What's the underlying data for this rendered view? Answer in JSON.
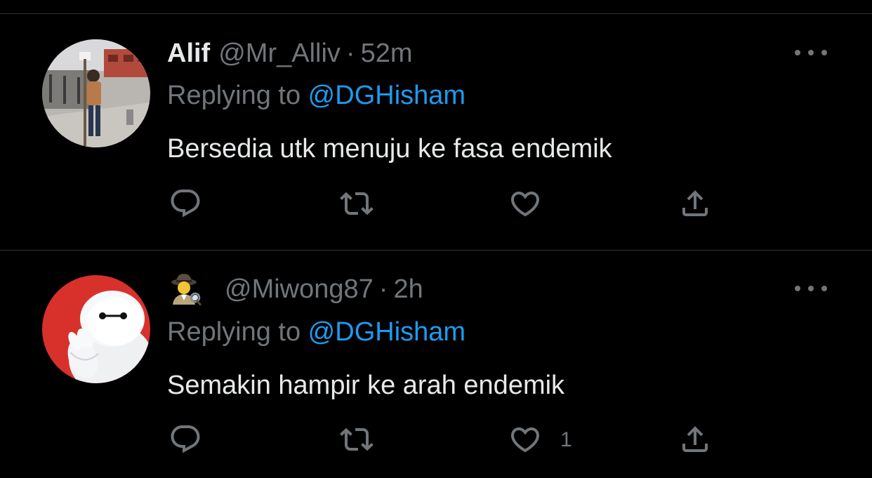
{
  "tweets": [
    {
      "display_name": "Alif",
      "handle": "@Mr_Alliv",
      "separator": "·",
      "time": "52m",
      "replying_prefix": "Replying to ",
      "replying_handle": "@DGHisham",
      "text": "Bersedia utk menuju ke fasa endemik",
      "like_count": "",
      "avatar_icon": "user-photo-avatar",
      "name_icon": ""
    },
    {
      "display_name": "",
      "handle": "@Miwong87",
      "separator": "·",
      "time": "2h",
      "replying_prefix": "Replying to ",
      "replying_handle": "@DGHisham",
      "text": "Semakin hampir ke arah endemik",
      "like_count": "1",
      "avatar_icon": "baymax-avatar",
      "name_icon": "detective-emoji"
    }
  ],
  "colors": {
    "background": "#000000",
    "text": "#e7e9ea",
    "muted": "#71767b",
    "link": "#1d9bf0",
    "divider": "#2f3336"
  }
}
